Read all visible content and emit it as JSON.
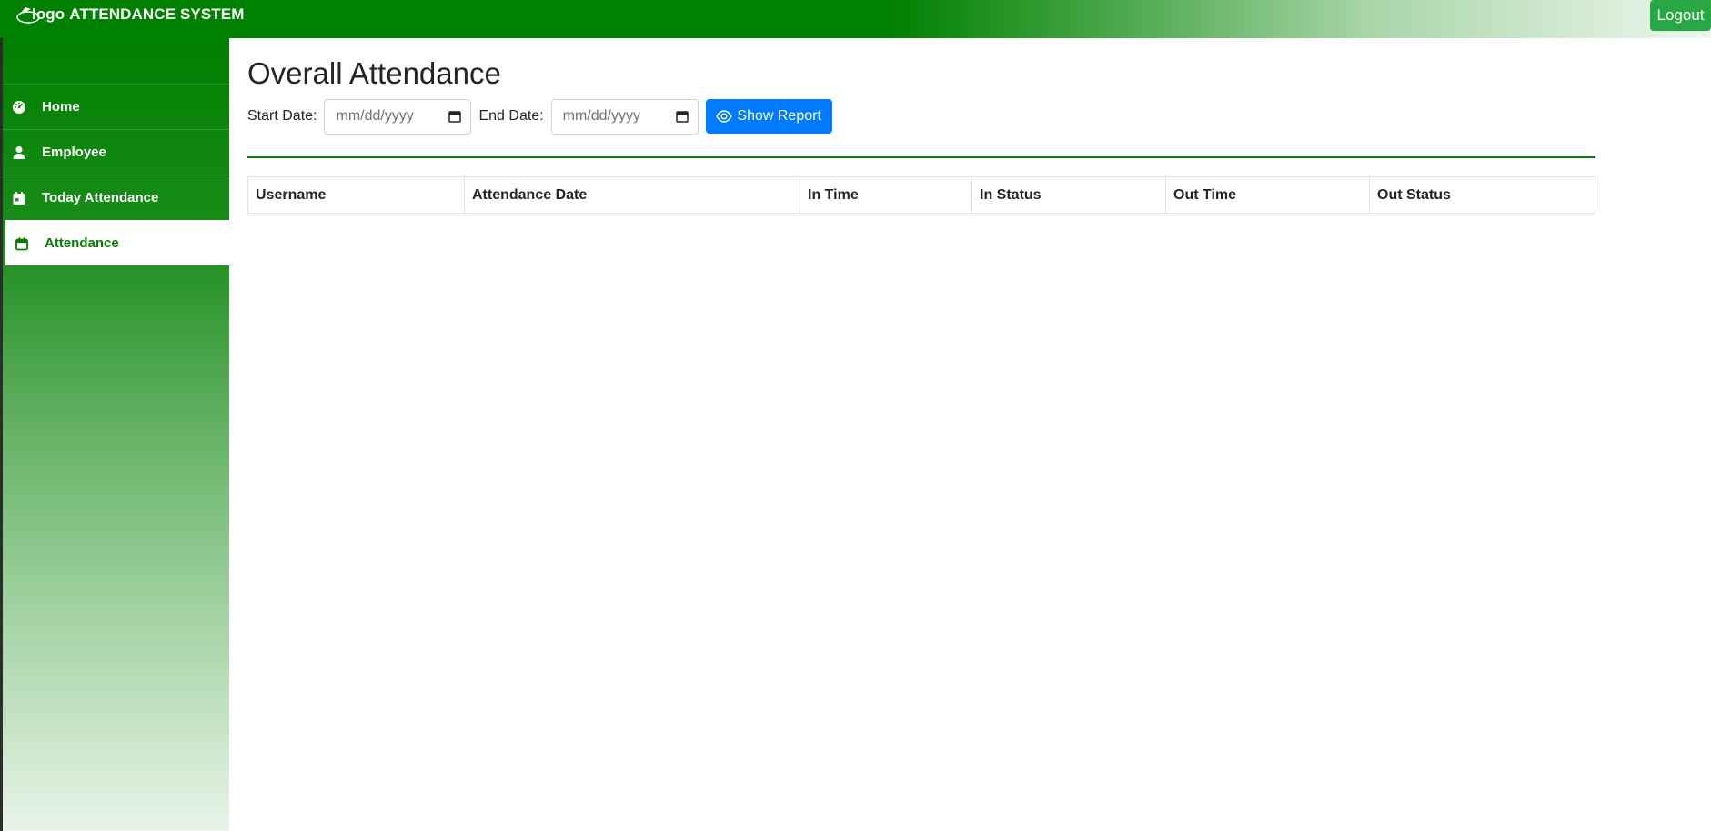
{
  "header": {
    "logo_alt": "logo",
    "brand_text": "ATTENDANCE SYSTEM",
    "logout_label": "Logout",
    "colors": {
      "brand_green": "#008000",
      "logout_green": "#28a745"
    }
  },
  "sidebar": {
    "items": [
      {
        "label": "Home",
        "icon": "dashboard-icon",
        "active": false
      },
      {
        "label": "Employee",
        "icon": "user-icon",
        "active": false
      },
      {
        "label": "Today Attendance",
        "icon": "calendar-day-icon",
        "active": false
      },
      {
        "label": "Attendance",
        "icon": "calendar-icon",
        "active": true
      }
    ]
  },
  "main": {
    "title": "Overall Attendance",
    "filters": {
      "start_label": "Start Date:",
      "start_placeholder": "mm/dd/yyyy",
      "end_label": "End Date:",
      "end_placeholder": "mm/dd/yyyy",
      "show_report_label": "Show Report",
      "show_report_color": "#007bff"
    },
    "table": {
      "columns": [
        "Username",
        "Attendance Date",
        "In Time",
        "In Status",
        "Out Time",
        "Out Status"
      ],
      "rows": []
    }
  }
}
